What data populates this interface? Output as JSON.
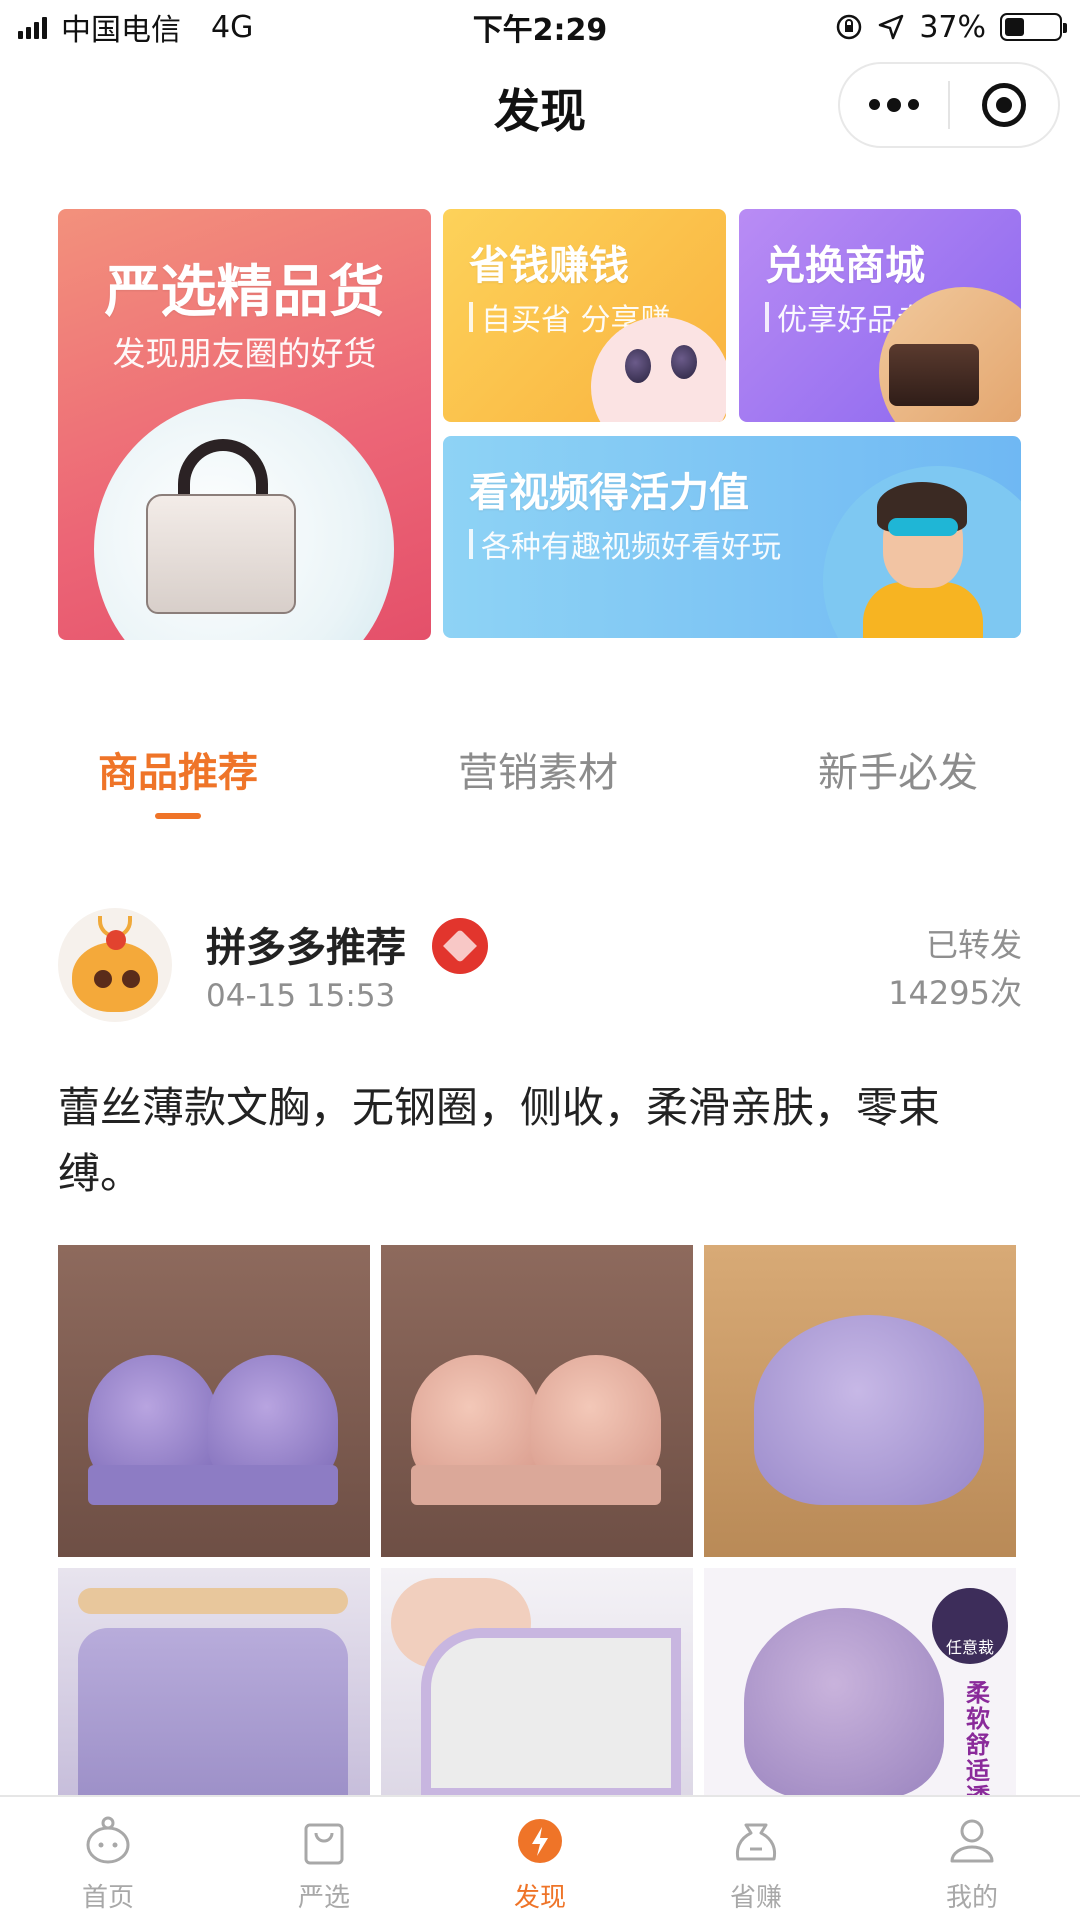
{
  "status_bar": {
    "carrier": "中国电信",
    "network": "4G",
    "time": "下午2:29",
    "battery": "37%",
    "battery_level": 0.37
  },
  "nav": {
    "title": "发现"
  },
  "banners": {
    "main": {
      "title": "严选精品货",
      "subtitle": "发现朋友圈的好货"
    },
    "save": {
      "title": "省钱赚钱",
      "subtitle": "自买省 分享赚"
    },
    "exchange": {
      "title": "兑换商城",
      "subtitle": "优享好品专享"
    },
    "video": {
      "title": "看视频得活力值",
      "subtitle": "各种有趣视频好看好玩"
    }
  },
  "tabs": [
    {
      "label": "商品推荐",
      "active": true
    },
    {
      "label": "营销素材",
      "active": false
    },
    {
      "label": "新手必发",
      "active": false
    }
  ],
  "post": {
    "author": "拼多多推荐",
    "time": "04-15 15:53",
    "forward_label": "已转发",
    "forward_count": "14295次",
    "text": "蕾丝薄款文胸，无钢圈，侧收，柔滑亲肤，零束缚。",
    "image_6_labels": {
      "badge": "任意裁",
      "vertical": "柔软舒适透"
    }
  },
  "tabbar": [
    {
      "label": "首页",
      "icon": "chick-home-icon",
      "active": false
    },
    {
      "label": "严选",
      "icon": "shopping-bag-icon",
      "active": false
    },
    {
      "label": "发现",
      "icon": "lightning-icon",
      "active": true
    },
    {
      "label": "省赚",
      "icon": "money-bag-icon",
      "active": false
    },
    {
      "label": "我的",
      "icon": "user-icon",
      "active": false
    }
  ],
  "colors": {
    "accent": "#ef7428",
    "inactive": "#a8a8a8"
  }
}
